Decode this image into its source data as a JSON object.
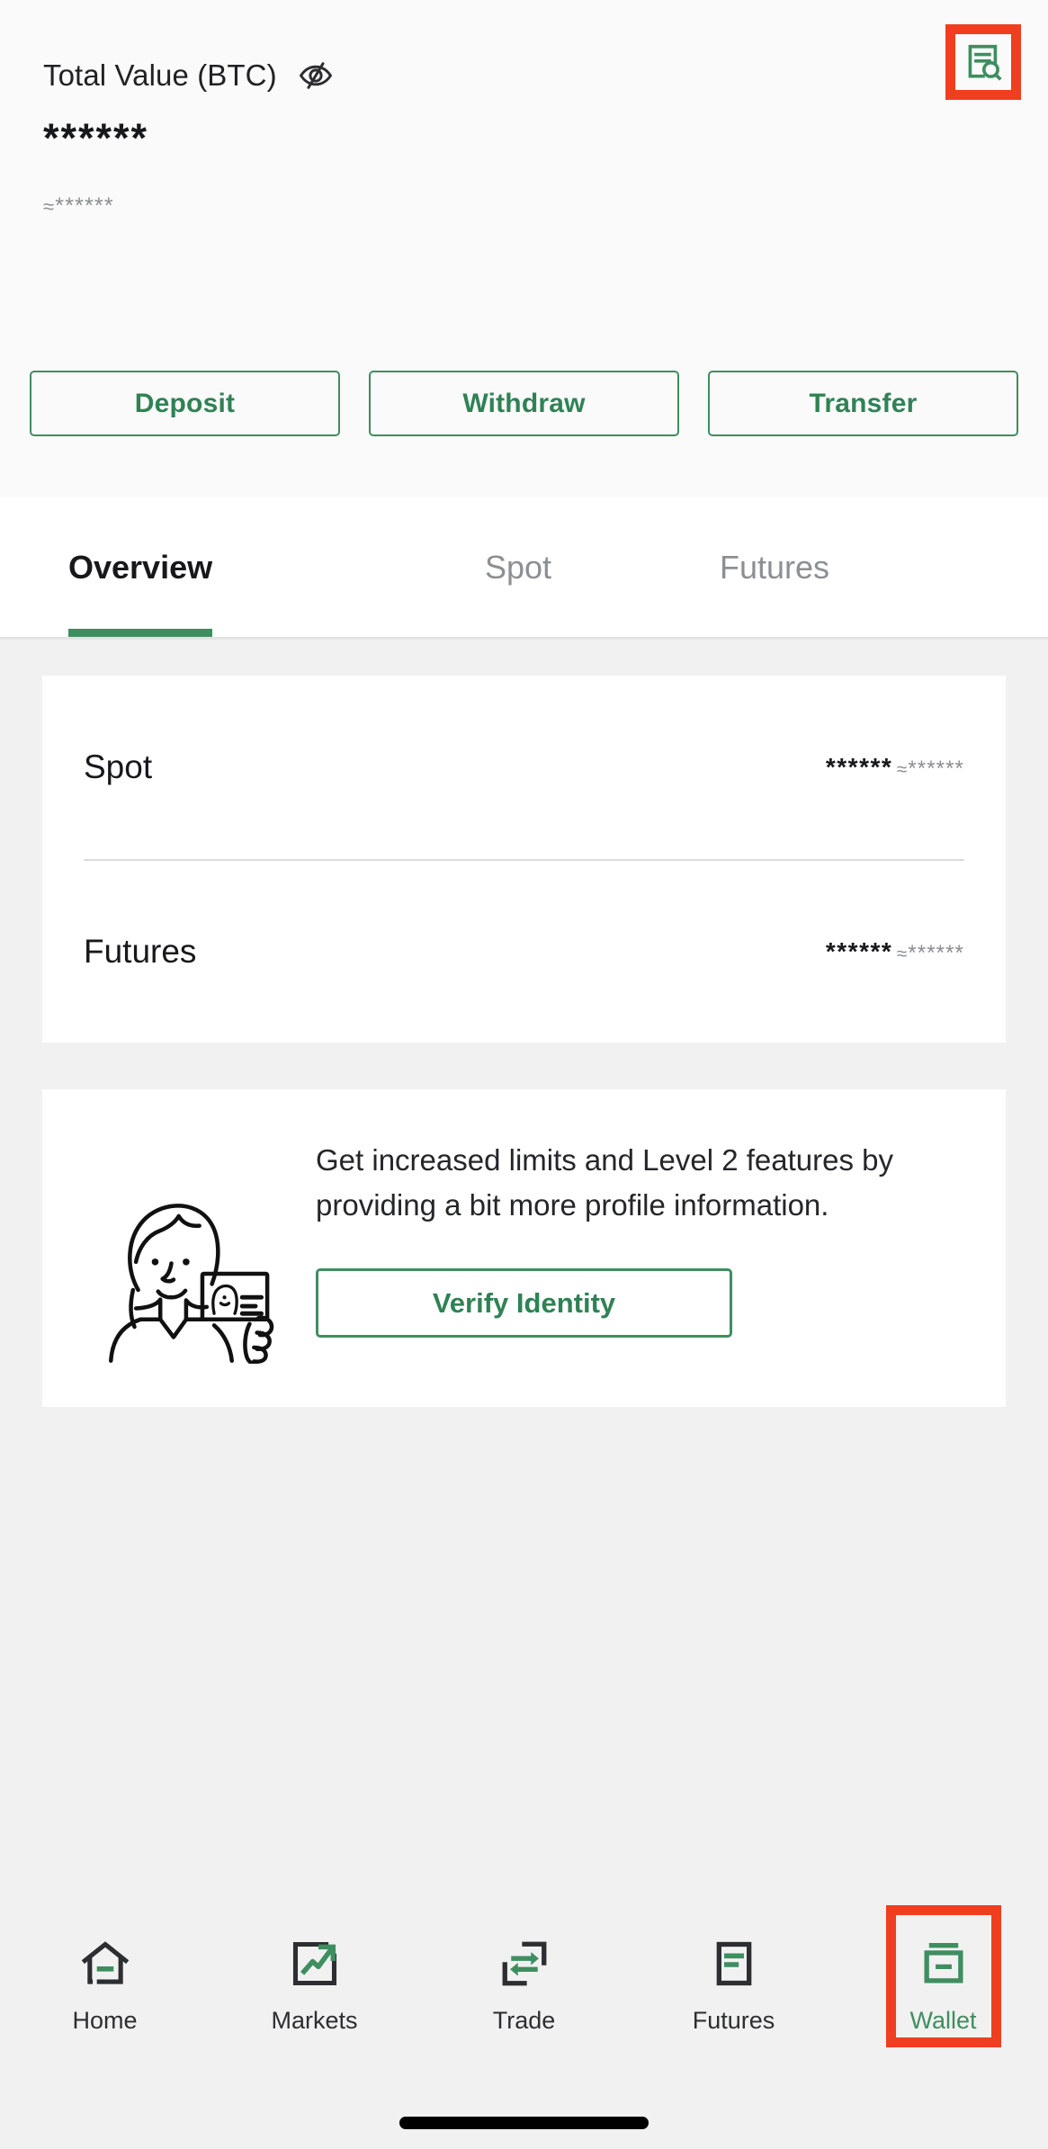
{
  "colors": {
    "brand_green": "#3E8E5F",
    "highlight_red": "#F03E20",
    "page_bg": "#F1F1F1",
    "header_bg": "#FAFAFA",
    "card_bg": "#FFFFFF",
    "text_primary": "#16181C",
    "text_muted": "#8A8D91"
  },
  "header": {
    "total_label": "Total Value (BTC)",
    "visibility_icon": "eye-slash-icon",
    "masked_value": "******",
    "approx_prefix": "≈",
    "approx_value": "******",
    "records_icon": "document-search-icon"
  },
  "actions": [
    {
      "label": "Deposit",
      "name": "deposit-button"
    },
    {
      "label": "Withdraw",
      "name": "withdraw-button"
    },
    {
      "label": "Transfer",
      "name": "transfer-button"
    }
  ],
  "tabs": [
    {
      "label": "Overview",
      "active": true
    },
    {
      "label": "Spot",
      "active": false
    },
    {
      "label": "Futures",
      "active": false
    }
  ],
  "balances": [
    {
      "name": "Spot",
      "primary": "******",
      "approx_prefix": "≈",
      "approx_value": "******"
    },
    {
      "name": "Futures",
      "primary": "******",
      "approx_prefix": "≈",
      "approx_value": "******"
    }
  ],
  "kyc": {
    "illustration": "person-holding-id-card-illustration",
    "message": "Get increased limits and Level 2 features by providing a bit more profile information.",
    "button_label": "Verify Identity"
  },
  "bottom_nav": [
    {
      "label": "Home",
      "icon": "home-icon",
      "active": false,
      "highlighted": false
    },
    {
      "label": "Markets",
      "icon": "markets-icon",
      "active": false,
      "highlighted": false
    },
    {
      "label": "Trade",
      "icon": "trade-icon",
      "active": false,
      "highlighted": false
    },
    {
      "label": "Futures",
      "icon": "futures-icon",
      "active": false,
      "highlighted": false
    },
    {
      "label": "Wallet",
      "icon": "wallet-icon",
      "active": true,
      "highlighted": true
    }
  ]
}
